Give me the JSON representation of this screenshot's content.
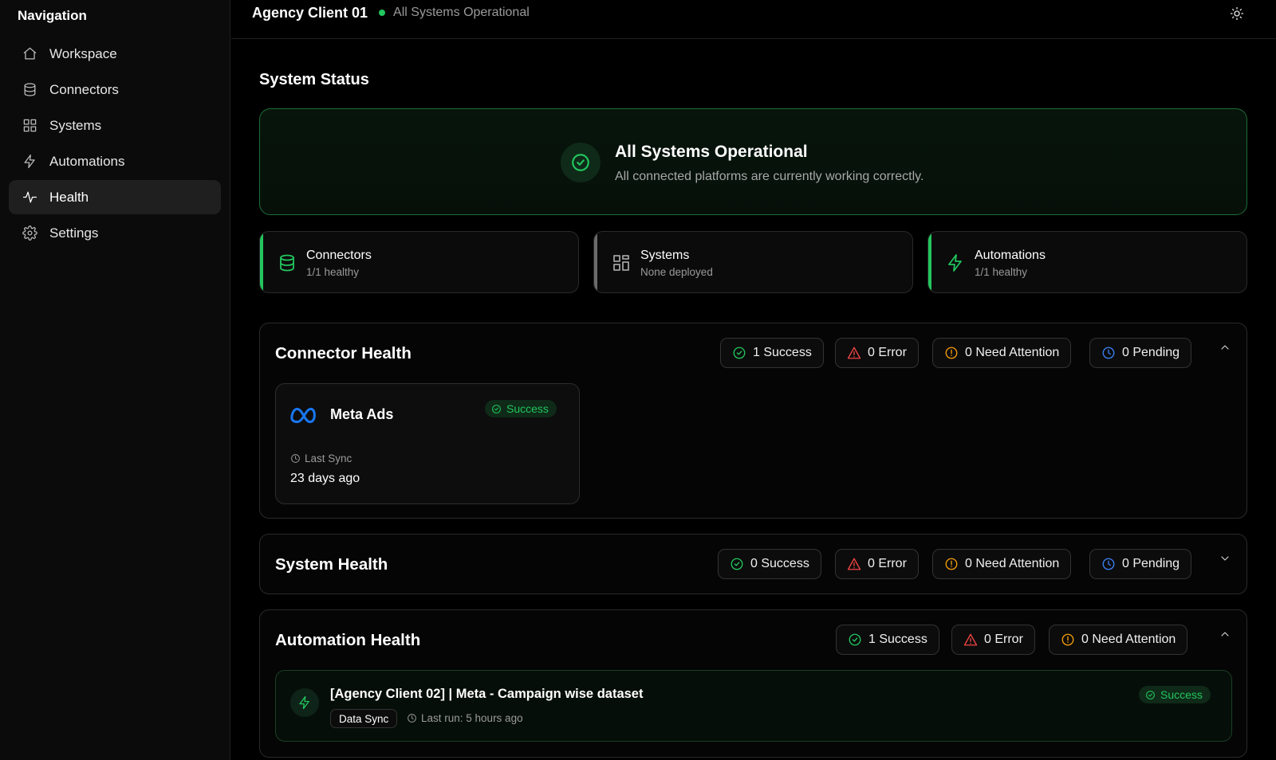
{
  "sidebar": {
    "title": "Navigation",
    "items": [
      {
        "label": "Workspace",
        "icon": "home-icon"
      },
      {
        "label": "Connectors",
        "icon": "database-icon"
      },
      {
        "label": "Systems",
        "icon": "grid-icon"
      },
      {
        "label": "Automations",
        "icon": "bolt-icon"
      },
      {
        "label": "Health",
        "icon": "activity-icon",
        "active": true
      },
      {
        "label": "Settings",
        "icon": "gear-icon"
      }
    ]
  },
  "header": {
    "client_name": "Agency Client 01",
    "status_text": "All Systems Operational",
    "theme_toggle_icon": "sun-icon"
  },
  "page": {
    "title": "System Status"
  },
  "banner": {
    "title": "All Systems Operational",
    "subtitle": "All connected platforms are currently working correctly."
  },
  "summary": [
    {
      "title": "Connectors",
      "sub": "1/1 healthy",
      "icon": "database-icon",
      "accent": "#22c55e"
    },
    {
      "title": "Systems",
      "sub": "None deployed",
      "icon": "grid-icon",
      "accent": "#6b6b6b"
    },
    {
      "title": "Automations",
      "sub": "1/1 healthy",
      "icon": "bolt-icon",
      "accent": "#22c55e"
    }
  ],
  "connector_health": {
    "title": "Connector Health",
    "chips": {
      "success": "1 Success",
      "error": "0 Error",
      "attention": "0 Need Attention",
      "pending": "0 Pending"
    },
    "connector": {
      "name": "Meta Ads",
      "status": "Success",
      "last_sync_label": "Last Sync",
      "last_sync_value": "23 days ago"
    }
  },
  "system_health": {
    "title": "System Health",
    "chips": {
      "success": "0 Success",
      "error": "0 Error",
      "attention": "0 Need Attention",
      "pending": "0 Pending"
    }
  },
  "automation_health": {
    "title": "Automation Health",
    "chips": {
      "success": "1 Success",
      "error": "0 Error",
      "attention": "0 Need Attention"
    },
    "automation": {
      "title": "[Agency Client 02] | Meta - Campaign wise dataset",
      "tag": "Data Sync",
      "last_run": "Last run: 5 hours ago",
      "status": "Success"
    }
  },
  "colors": {
    "success": "#22c55e",
    "error": "#ef4444",
    "attention": "#f59e0b",
    "pending": "#3b82f6",
    "meta_blue": "#1877f2"
  }
}
